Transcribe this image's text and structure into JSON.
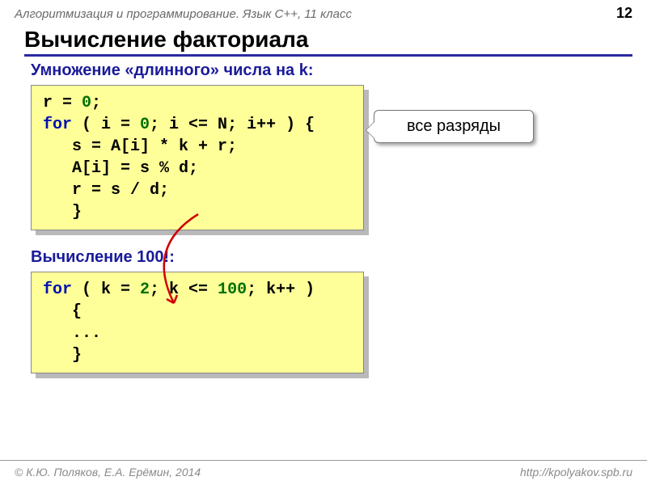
{
  "header": {
    "course": "Алгоритмизация и программирование. Язык C++, 11 класс",
    "page": "12"
  },
  "title": "Вычисление факториала",
  "section1": {
    "heading": "Умножение «длинного» числа на k:",
    "code": {
      "l1": {
        "a": "r = ",
        "n0": "0",
        "b": ";"
      },
      "l2": {
        "kw": "for",
        "a": " ( i = ",
        "n0": "0",
        "b": "; i <= N; i++ ) {"
      },
      "l3": "   s = A[i] * k + r;",
      "l4": "   A[i] = s % d;",
      "l5": "   r = s / d;",
      "l6": "   }"
    }
  },
  "callout": "все разряды",
  "section2": {
    "heading": "Вычисление 100!:",
    "code": {
      "l1": {
        "kw": "for",
        "a": " ( k = ",
        "n2": "2",
        "b": "; k <= ",
        "n100": "100",
        "c": "; k++ )"
      },
      "l2": "   {",
      "l3": "   ...",
      "l4": "   }"
    }
  },
  "footer": {
    "left": "© К.Ю. Поляков, Е.А. Ерёмин, 2014",
    "right": "http://kpolyakov.spb.ru"
  }
}
